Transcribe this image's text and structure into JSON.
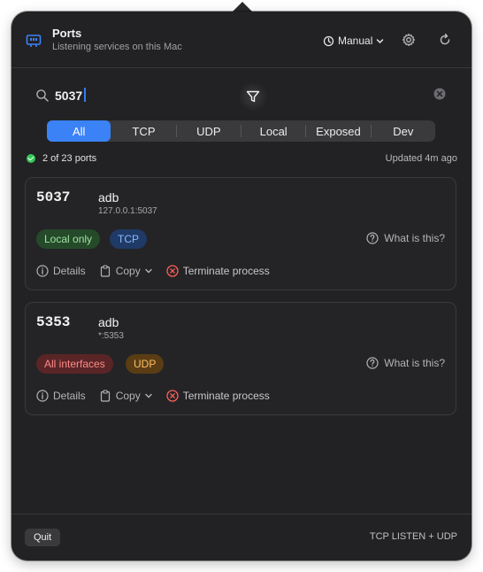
{
  "header": {
    "title": "Ports",
    "subtitle": "Listening services on this Mac",
    "refresh_mode": "Manual"
  },
  "search": {
    "value": "5037",
    "placeholder": ""
  },
  "tabs": [
    {
      "label": "All",
      "active": true
    },
    {
      "label": "TCP",
      "active": false
    },
    {
      "label": "UDP",
      "active": false
    },
    {
      "label": "Local",
      "active": false
    },
    {
      "label": "Exposed",
      "active": false
    },
    {
      "label": "Dev",
      "active": false
    }
  ],
  "status": {
    "count_text": "2 of 23 ports",
    "updated_text": "Updated 4m ago"
  },
  "results": [
    {
      "port": "5037",
      "process": "adb",
      "address": "127.0.0.1:5037",
      "scope_badge": "Local only",
      "protocol_badge": "TCP",
      "help_label": "What is this?",
      "details_label": "Details",
      "copy_label": "Copy",
      "terminate_label": "Terminate process"
    },
    {
      "port": "5353",
      "process": "adb",
      "address": "*:5353",
      "scope_badge": "All interfaces",
      "protocol_badge": "UDP",
      "help_label": "What is this?",
      "details_label": "Details",
      "copy_label": "Copy",
      "terminate_label": "Terminate process"
    }
  ],
  "footer": {
    "quit_label": "Quit",
    "mode_text": "TCP LISTEN + UDP"
  },
  "colors": {
    "accent": "#3b82f6",
    "success": "#34c759",
    "danger": "#ff5f57",
    "panel_bg": "#222224"
  }
}
